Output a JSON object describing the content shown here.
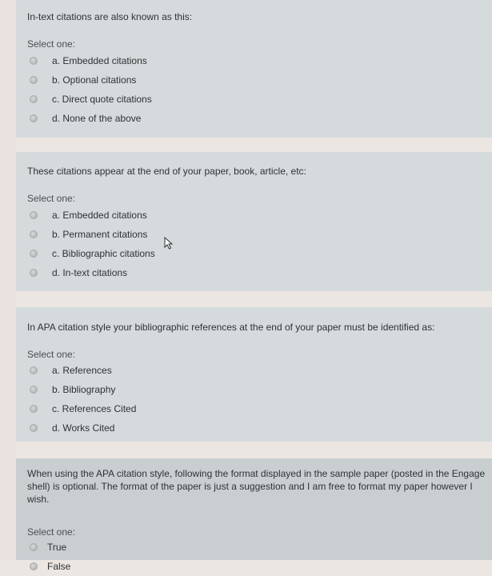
{
  "quiz": {
    "select_label": "Select one:",
    "questions": [
      {
        "text": "In-text citations are also known as this:",
        "answers": [
          "a. Embedded citations",
          "b. Optional citations",
          "c. Direct quote citations",
          "d. None of the above"
        ]
      },
      {
        "text": "These citations appear at the end of your paper, book, article, etc:",
        "answers": [
          "a. Embedded citations",
          "b. Permanent citations",
          "c. Bibliographic citations",
          "d. In-text citations"
        ]
      },
      {
        "text": "In APA citation style your bibliographic references at the end of your paper must be identified as:",
        "answers": [
          "a. References",
          "b. Bibliography",
          "c. References Cited",
          "d. Works Cited"
        ]
      },
      {
        "text": "When using the APA citation style, following the format displayed in the sample paper (posted in the Engage shell) is optional. The format of the paper is just a suggestion and I am free to format my paper however I wish.",
        "answers": [
          "True",
          "False"
        ]
      }
    ]
  },
  "icons": {
    "radio": "radio-unselected-icon",
    "cursor": "mouse-pointer-icon"
  },
  "colors": {
    "card_background": "#d5dbdc",
    "page_background": "#ece6e2",
    "text": "#2e3235"
  }
}
